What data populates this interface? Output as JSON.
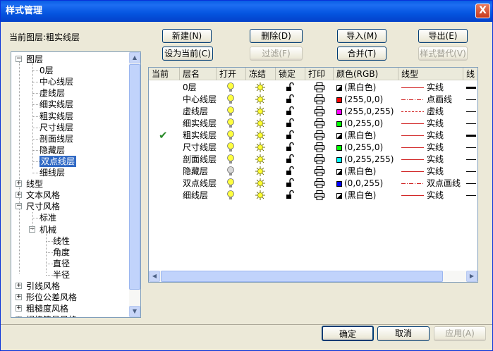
{
  "window": {
    "title": "样式管理",
    "close_label": "X"
  },
  "current_layer_label": "当前图层:粗实线层",
  "buttons": {
    "new": "新建(N)",
    "delete": "删除(D)",
    "import": "导入(M)",
    "export": "导出(E)",
    "set_current": "设为当前(C)",
    "filter": "过滤(F)",
    "merge": "合并(T)",
    "style_replace": "样式替代(V)"
  },
  "tree": {
    "root": "图层",
    "layers": [
      "0层",
      "中心线层",
      "虚线层",
      "细实线层",
      "粗实线层",
      "尺寸线层",
      "剖面线层",
      "隐藏层",
      "双点线层",
      "细线层"
    ],
    "selected": "双点线层",
    "linetype": "线型",
    "text_style": "文本风格",
    "dim_style": "尺寸风格",
    "standard": "标准",
    "mechanical": "机械",
    "mech_children": [
      "线性",
      "角度",
      "直径",
      "半径"
    ],
    "leader_style": "引线风格",
    "tolerance_style": "形位公差风格",
    "roughness_style": "粗糙度风格",
    "weld_style": "焊接符号风格"
  },
  "table": {
    "headers": [
      "当前",
      "层名",
      "打开",
      "冻结",
      "锁定",
      "打印",
      "颜色(RGB)",
      "线型",
      "线"
    ],
    "rows": [
      {
        "current": "",
        "name": "0层",
        "color_text": "(黑白色)",
        "color": "#000000",
        "bw": true,
        "linetype": "实线",
        "style": "solid",
        "bulb_on": true,
        "weight": "thick"
      },
      {
        "current": "",
        "name": "中心线层",
        "color_text": "(255,0,0)",
        "color": "#ff0000",
        "bw": false,
        "linetype": "点画线",
        "style": "dashdot",
        "bulb_on": true,
        "weight": "thin"
      },
      {
        "current": "",
        "name": "虚线层",
        "color_text": "(255,0,255)",
        "color": "#ff00ff",
        "bw": false,
        "linetype": "虚线",
        "style": "dashed",
        "bulb_on": true,
        "weight": "thin"
      },
      {
        "current": "",
        "name": "细实线层",
        "color_text": "(0,255,0)",
        "color": "#00ff00",
        "bw": false,
        "linetype": "实线",
        "style": "solid",
        "bulb_on": true,
        "weight": "thin"
      },
      {
        "current": "✔",
        "name": "粗实线层",
        "color_text": "(黑白色)",
        "color": "#000000",
        "bw": true,
        "linetype": "实线",
        "style": "solid",
        "bulb_on": true,
        "weight": "thick"
      },
      {
        "current": "",
        "name": "尺寸线层",
        "color_text": "(0,255,0)",
        "color": "#00ff00",
        "bw": false,
        "linetype": "实线",
        "style": "solid",
        "bulb_on": true,
        "weight": "thin"
      },
      {
        "current": "",
        "name": "剖面线层",
        "color_text": "(0,255,255)",
        "color": "#00ffff",
        "bw": false,
        "linetype": "实线",
        "style": "solid",
        "bulb_on": true,
        "weight": "thin"
      },
      {
        "current": "",
        "name": "隐藏层",
        "color_text": "(黑白色)",
        "color": "#000000",
        "bw": true,
        "linetype": "实线",
        "style": "solid",
        "bulb_on": false,
        "weight": "thin"
      },
      {
        "current": "",
        "name": "双点线层",
        "color_text": "(0,0,255)",
        "color": "#0000ff",
        "bw": false,
        "linetype": "双点画线",
        "style": "dashdot",
        "bulb_on": true,
        "weight": "thin"
      },
      {
        "current": "",
        "name": "细线层",
        "color_text": "(黑白色)",
        "color": "#000000",
        "bw": true,
        "linetype": "实线",
        "style": "solid",
        "bulb_on": true,
        "weight": "thin"
      }
    ]
  },
  "footer": {
    "ok": "确定",
    "cancel": "取消",
    "apply": "应用(A)"
  }
}
